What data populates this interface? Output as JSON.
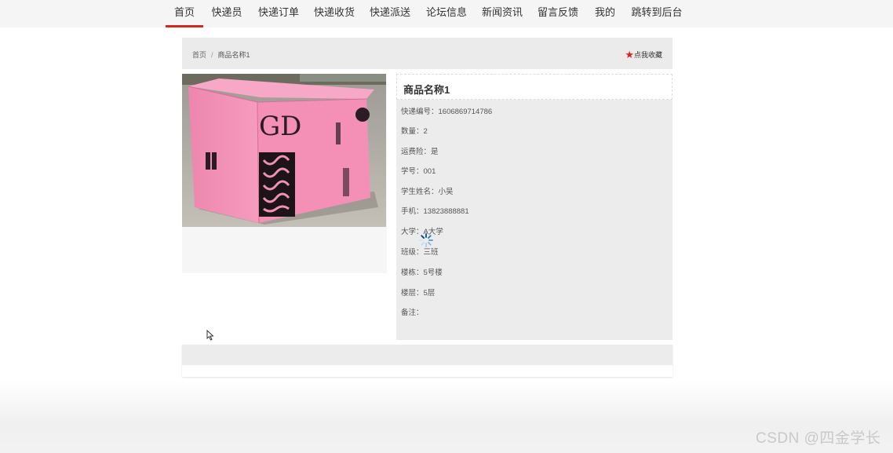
{
  "nav": {
    "items": [
      {
        "label": "首页",
        "active": true
      },
      {
        "label": "快递员"
      },
      {
        "label": "快递订单"
      },
      {
        "label": "快递收货"
      },
      {
        "label": "快递派送"
      },
      {
        "label": "论坛信息"
      },
      {
        "label": "新闻资讯"
      },
      {
        "label": "留言反馈"
      },
      {
        "label": "我的"
      },
      {
        "label": "跳转到后台"
      }
    ],
    "active_color": "#d9261c"
  },
  "breadcrumb": {
    "home": "首页",
    "separator": "/",
    "current": "商品名称1"
  },
  "favorite": {
    "label": "点我收藏",
    "icon": "star-icon",
    "icon_color": "#e02020"
  },
  "product": {
    "title": "商品名称1",
    "image_description_icon": "pink-cardboard-box-photo",
    "fields": [
      {
        "text": "快递编号：1606869714786"
      },
      {
        "text": "数量：2"
      },
      {
        "text": "运费险：是"
      },
      {
        "text": "学号：001"
      },
      {
        "text": "学生姓名：小吴"
      },
      {
        "text": "手机：13823888881"
      },
      {
        "text": "大学：A大学"
      },
      {
        "text": "班级：三班"
      },
      {
        "text": "楼栋：5号楼"
      },
      {
        "text": "楼层：5层"
      },
      {
        "text": "备注："
      }
    ]
  },
  "watermark": "CSDN @四金学长"
}
